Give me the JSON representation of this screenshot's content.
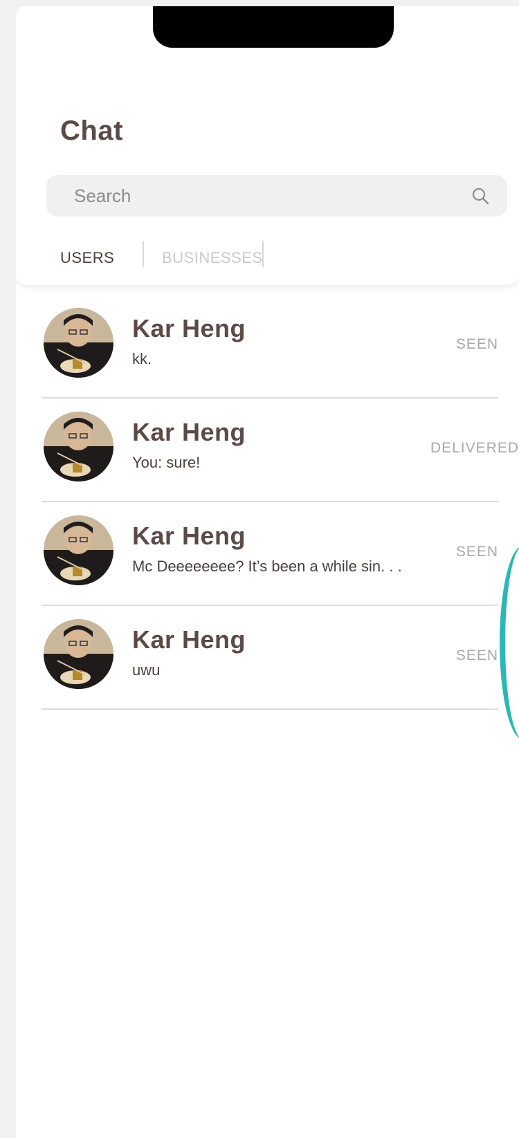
{
  "header": {
    "title": "Chat"
  },
  "search": {
    "placeholder": "Search"
  },
  "tabs": [
    {
      "label": "USERS",
      "active": true
    },
    {
      "label": "BUSINESSES",
      "active": false
    }
  ],
  "conversations": [
    {
      "name": "Kar Heng",
      "preview": "kk.",
      "status": "SEEN"
    },
    {
      "name": "Kar Heng",
      "preview": "You: sure!",
      "status": "DELIVERED"
    },
    {
      "name": "Kar Heng",
      "preview": "Mc Deeeeeeee? It’s been a while sin. . .",
      "status": "SEEN"
    },
    {
      "name": "Kar Heng",
      "preview": "uwu",
      "status": "SEEN"
    }
  ],
  "colors": {
    "title": "#5b4a47",
    "inactive_tab": "#c9c9c9",
    "status": "#a8a8a8",
    "accent": "#2bb7b5"
  },
  "icons": {
    "search": "search-icon",
    "avatar": "avatar"
  }
}
